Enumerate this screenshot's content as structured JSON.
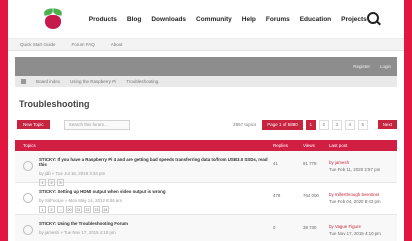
{
  "nav": {
    "items": [
      "Products",
      "Blog",
      "Downloads",
      "Community",
      "Help",
      "Forums",
      "Education",
      "Projects"
    ]
  },
  "quicklinks": [
    "Quick Start Guide",
    "Forum FAQ",
    "About"
  ],
  "darkbar": {
    "left": [
      "",
      ""
    ],
    "right": [
      "Register",
      "Login"
    ]
  },
  "breadcrumb": [
    "Board index",
    "Using the Raspberry Pi",
    "Troubleshooting"
  ],
  "title": "Troubleshooting",
  "actions": {
    "new_topic": "New Topic",
    "search_placeholder": "Search this forum...",
    "topics_count": "2857 topics",
    "pager": [
      "Page 1 of 5880",
      "1",
      "2",
      "3",
      "4",
      "5"
    ],
    "next": "Next"
  },
  "table": {
    "headers": {
      "topics": "Topics",
      "replies": "Replies",
      "views": "Views",
      "last": "Last post"
    },
    "rows": [
      {
        "title": "STICKY: If you have a Raspberry Pi 4 and are getting bad speeds transferring data to/from USB3.0 SSDs, read this",
        "meta": "by jdb » Tue Jul 16, 2019 3:34 pm",
        "pages": [
          "1",
          "2",
          "3"
        ],
        "replies": "41",
        "views": "91 779",
        "last_by": "by jamesh",
        "last_date": "Tue Feb 11, 2020 2:57 pm"
      },
      {
        "title": "STICKY: Setting up HDMI output when video output is wrong",
        "meta": "by SirFooLie » Mon May 14, 2012 8:06 am",
        "pages": [
          "1",
          "2",
          "...",
          "20",
          "21",
          "22",
          "23",
          "24"
        ],
        "replies": "478",
        "views": "764 000",
        "last_by": "by millerthrough 5ventinet",
        "last_date": "Tue Feb 04, 2020 8:43 pm"
      },
      {
        "title": "STICKY: Using the Troubleshooting Forum",
        "meta": "by jamesh » Tue Nov 17, 2015 4:10 pm",
        "pages": [],
        "replies": "0",
        "views": "38 730",
        "last_by": "by Vague Figure",
        "last_date": "Tue Nov 17, 2015 4:10 pm"
      }
    ]
  },
  "colors": {
    "accent": "#c7253f",
    "border": "#e2173f",
    "dark_bar": "#8d8d8d"
  }
}
